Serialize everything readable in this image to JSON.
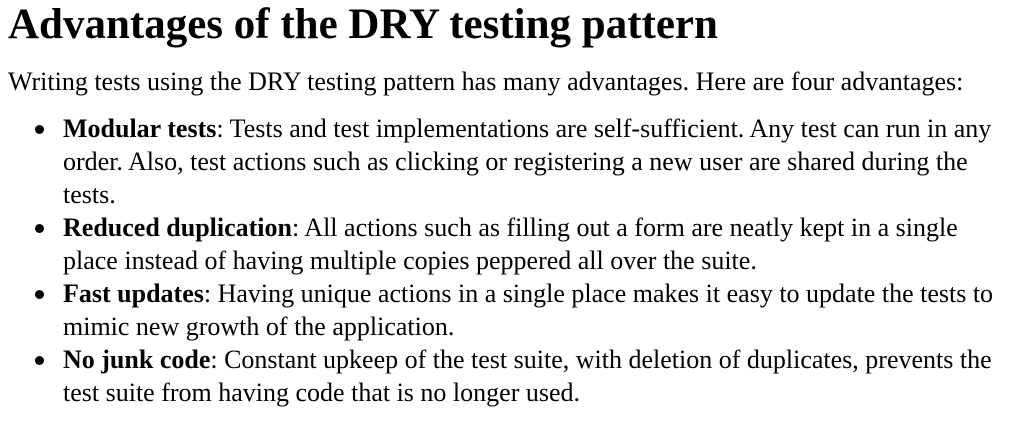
{
  "heading": "Advantages of the DRY testing pattern",
  "intro": "Writing tests using the DRY testing pattern has many advantages. Here are four advantages:",
  "items": [
    {
      "term": "Modular tests",
      "separator": ":",
      "description": " Tests and test implementations are self-sufficient. Any test can run in any order. Also, test actions such as clicking or registering a new user are shared during the tests."
    },
    {
      "term": "Reduced duplication",
      "separator": ":",
      "description": " All actions such as filling out a form are neatly kept in a single place instead of having multiple copies peppered all over the suite."
    },
    {
      "term": "Fast updates",
      "separator": ":",
      "description": " Having unique actions in a single place makes it easy to update the tests to mimic new growth of the application."
    },
    {
      "term": "No junk code",
      "separator": ":",
      "description": " Constant upkeep of the test suite, with deletion of duplicates, prevents the test suite from having code that is no longer used."
    }
  ]
}
